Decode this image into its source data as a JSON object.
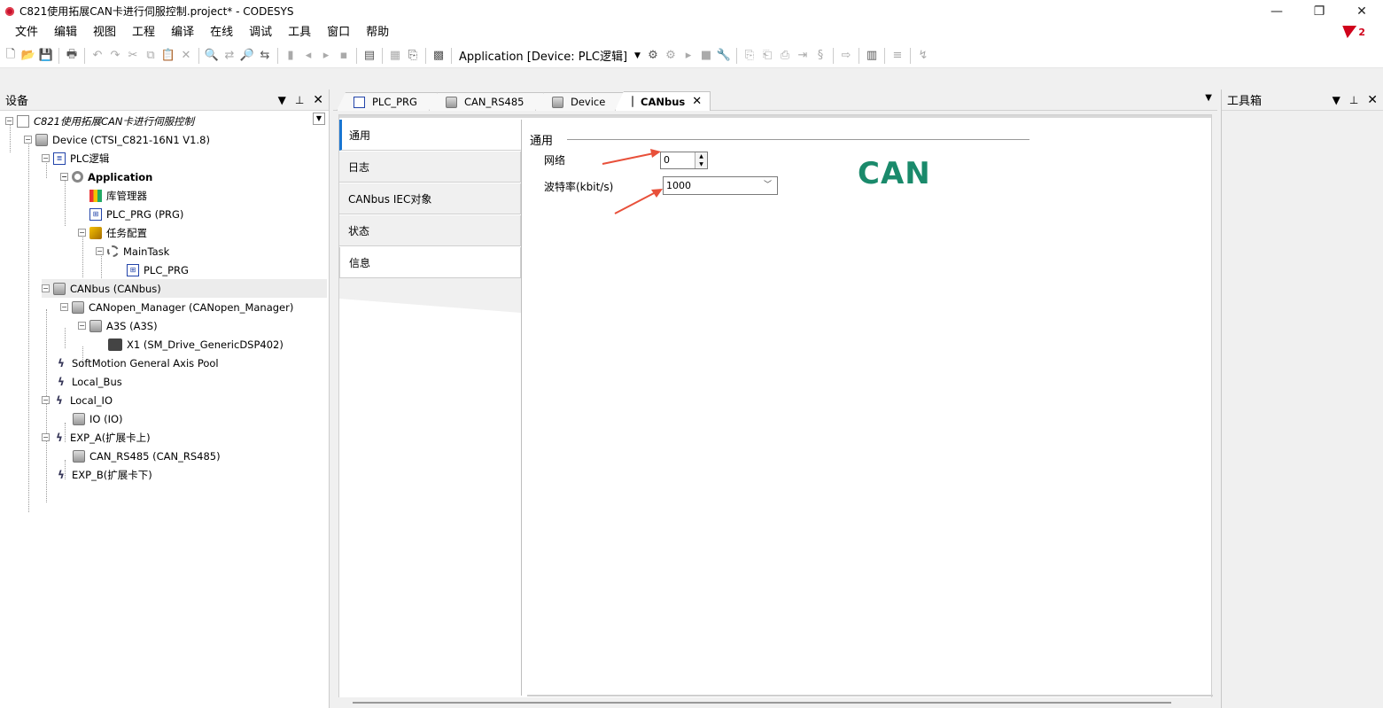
{
  "window": {
    "title": "C821使用拓展CAN卡进行伺服控制.project* - CODESYS",
    "minimize": "—",
    "restore": "❐",
    "close": "✕"
  },
  "menu": [
    "文件",
    "编辑",
    "视图",
    "工程",
    "编译",
    "在线",
    "调试",
    "工具",
    "窗口",
    "帮助"
  ],
  "alerts": {
    "count": "2",
    "color": "#d0021b"
  },
  "toolbar": {
    "active_app": "Application [Device: PLC逻辑]"
  },
  "devices_panel": {
    "title": "设备",
    "tree": [
      {
        "label": "C821使用拓展CAN卡进行伺服控制",
        "icon": "project-icon"
      },
      {
        "label": "Device (CTSI_C821-16N1 V1.8)",
        "icon": "device-icon"
      },
      {
        "label": "PLC逻辑",
        "icon": "plc-logic-icon"
      },
      {
        "label": "Application",
        "icon": "application-icon"
      },
      {
        "label": "库管理器",
        "icon": "library-manager-icon"
      },
      {
        "label": "PLC_PRG (PRG)",
        "icon": "program-icon"
      },
      {
        "label": "任务配置",
        "icon": "task-config-icon"
      },
      {
        "label": "MainTask",
        "icon": "task-icon"
      },
      {
        "label": "PLC_PRG",
        "icon": "program-call-icon"
      },
      {
        "label": "CANbus (CANbus)",
        "icon": "device-icon"
      },
      {
        "label": "CANopen_Manager (CANopen_Manager)",
        "icon": "device-icon"
      },
      {
        "label": "A3S (A3S)",
        "icon": "device-icon"
      },
      {
        "label": "X1 (SM_Drive_GenericDSP402)",
        "icon": "drive-icon"
      },
      {
        "label": "SoftMotion General Axis Pool",
        "icon": "axis-pool-icon"
      },
      {
        "label": "Local_Bus",
        "icon": "bus-icon"
      },
      {
        "label": "Local_IO",
        "icon": "bus-icon"
      },
      {
        "label": "IO (IO)",
        "icon": "device-icon"
      },
      {
        "label": "EXP_A(扩展卡上)",
        "icon": "bus-icon"
      },
      {
        "label": "CAN_RS485 (CAN_RS485)",
        "icon": "device-icon"
      },
      {
        "label": "EXP_B(扩展卡下)",
        "icon": "bus-icon"
      }
    ]
  },
  "editor": {
    "tabs": [
      {
        "label": "PLC_PRG"
      },
      {
        "label": "CAN_RS485"
      },
      {
        "label": "Device"
      },
      {
        "label": "CANbus",
        "close": "✕"
      }
    ],
    "subtabs": [
      "通用",
      "日志",
      "CANbus IEC对象",
      "状态",
      "信息"
    ],
    "general": {
      "section_title": "通用",
      "network_label": "网络",
      "network_value": "0",
      "baudrate_label": "波特率(kbit/s)",
      "baudrate_value": "1000",
      "logo_text": "CAN"
    }
  },
  "toolbox_panel": {
    "title": "工具箱"
  },
  "colors": {
    "accent": "#1976d2",
    "can_logo": "#1a8a6b",
    "annotation_arrow": "#e8503a"
  }
}
